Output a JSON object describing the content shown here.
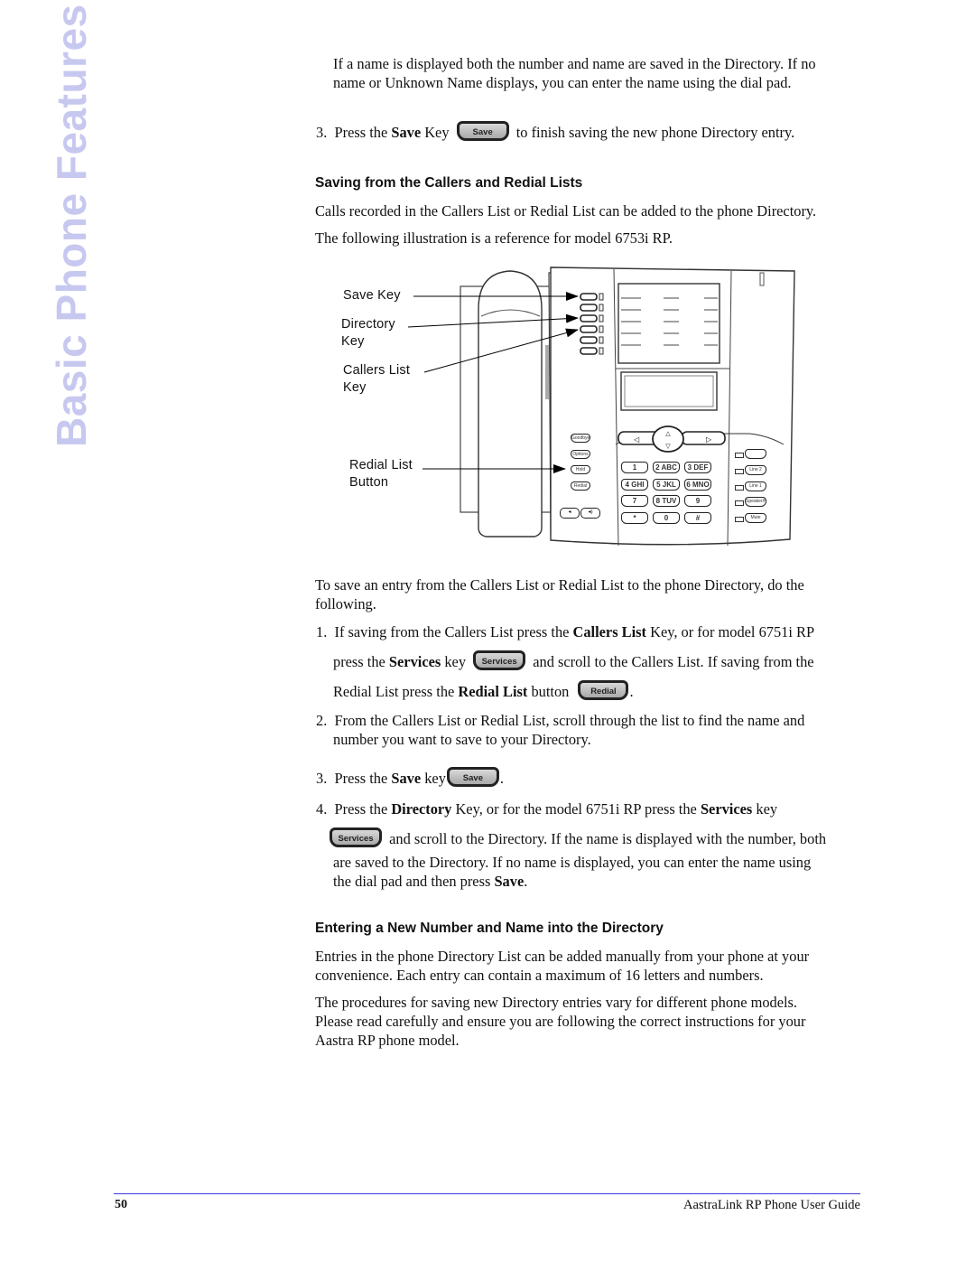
{
  "sidebar": {
    "section_title": "Basic Phone Features"
  },
  "intro": {
    "line1": "If a name is displayed both the number and name are saved in the Directory. If no",
    "line2": "name or Unknown Name displays, you can enter the name using the dial pad."
  },
  "step3_top": {
    "num": "3.",
    "pre": "Press the ",
    "bold": "Save",
    "mid": " Key",
    "key_label": "Save",
    "post": "to finish saving the new phone Directory entry."
  },
  "section1": {
    "heading": "Saving from the Callers and Redial Lists",
    "para1": "Calls recorded in the Callers List or Redial List can be added to the phone Directory.",
    "para2": "The following illustration is a reference for model 6753i RP."
  },
  "figure": {
    "callouts": [
      {
        "line1": "Save Key",
        "line2": ""
      },
      {
        "line1": "Directory",
        "line2": "Key"
      },
      {
        "line1": "Callers List",
        "line2": "Key"
      },
      {
        "line1": "Redial List",
        "line2": "Button"
      }
    ],
    "left_buttons": [
      "Goodbye",
      "Options",
      "Hold",
      "Redial"
    ],
    "right_buttons": [
      "",
      "Line 2",
      "Line 1",
      "Speaker/Headset",
      "Mute"
    ],
    "keypad": [
      [
        "1",
        "2 ABC",
        "3 DEF"
      ],
      [
        "4 GHI",
        "5 JKL",
        "6 MNO"
      ],
      [
        "7 PQRS",
        "8 TUV",
        "9 WXYZ"
      ],
      [
        "*",
        "0",
        "#"
      ]
    ]
  },
  "section1_body": {
    "para_line1": "To save an entry from the Callers List or Redial List to the phone Directory, do the",
    "para_line2": "following.",
    "step1": {
      "num": "1.",
      "l1_pre": "If saving from the Callers List press the ",
      "l1_bold": "Callers List",
      "l1_post": " Key, or for model 6751i RP",
      "l2_pre": "press the ",
      "l2_bold": "Services",
      "l2_mid": " key",
      "services_key": "Services",
      "l2_post": "and scroll to the Callers List. If saving from the",
      "l3_pre": "Redial List press the ",
      "l3_bold": "Redial List",
      "l3_mid": " button",
      "redial_key": "Redial",
      "l3_post": "."
    },
    "step2": {
      "num": "2.",
      "l1": "From the Callers List or Redial List, scroll through the list to find the name and",
      "l2": "number you want to save to your Directory."
    },
    "step3": {
      "num": "3.",
      "pre": "Press the ",
      "bold": "Save",
      "mid": " key",
      "key_label": "Save",
      "post": "."
    },
    "step4": {
      "num": "4.",
      "l1_pre": "Press the ",
      "l1_bold": "Directory",
      "l1_mid": " Key, or for the model 6751i RP press the ",
      "l1_bold2": "Services",
      "l1_post": " key",
      "services_key": "Services",
      "l2": "and scroll to the Directory. If the name is displayed with the number, both",
      "l3": "are saved to the Directory. If no name is displayed, you can enter the name using",
      "l4_pre": "the dial pad and then press ",
      "l4_bold": "Save",
      "l4_post": "."
    }
  },
  "section2": {
    "heading": "Entering a New Number and Name into the Directory",
    "p1_l1": "Entries in the phone Directory List can be added manually from your phone at your",
    "p1_l2": "convenience. Each entry can contain a maximum of 16 letters and numbers.",
    "p2_l1": "The procedures for saving new Directory entries vary for different phone models.",
    "p2_l2": "Please read carefully and ensure you are following the correct instructions for your",
    "p2_l3": "Aastra RP phone model."
  },
  "footer": {
    "page_number": "50",
    "guide_title": "AastraLink RP Phone User Guide",
    "rule_color": "#3a3ae0"
  }
}
